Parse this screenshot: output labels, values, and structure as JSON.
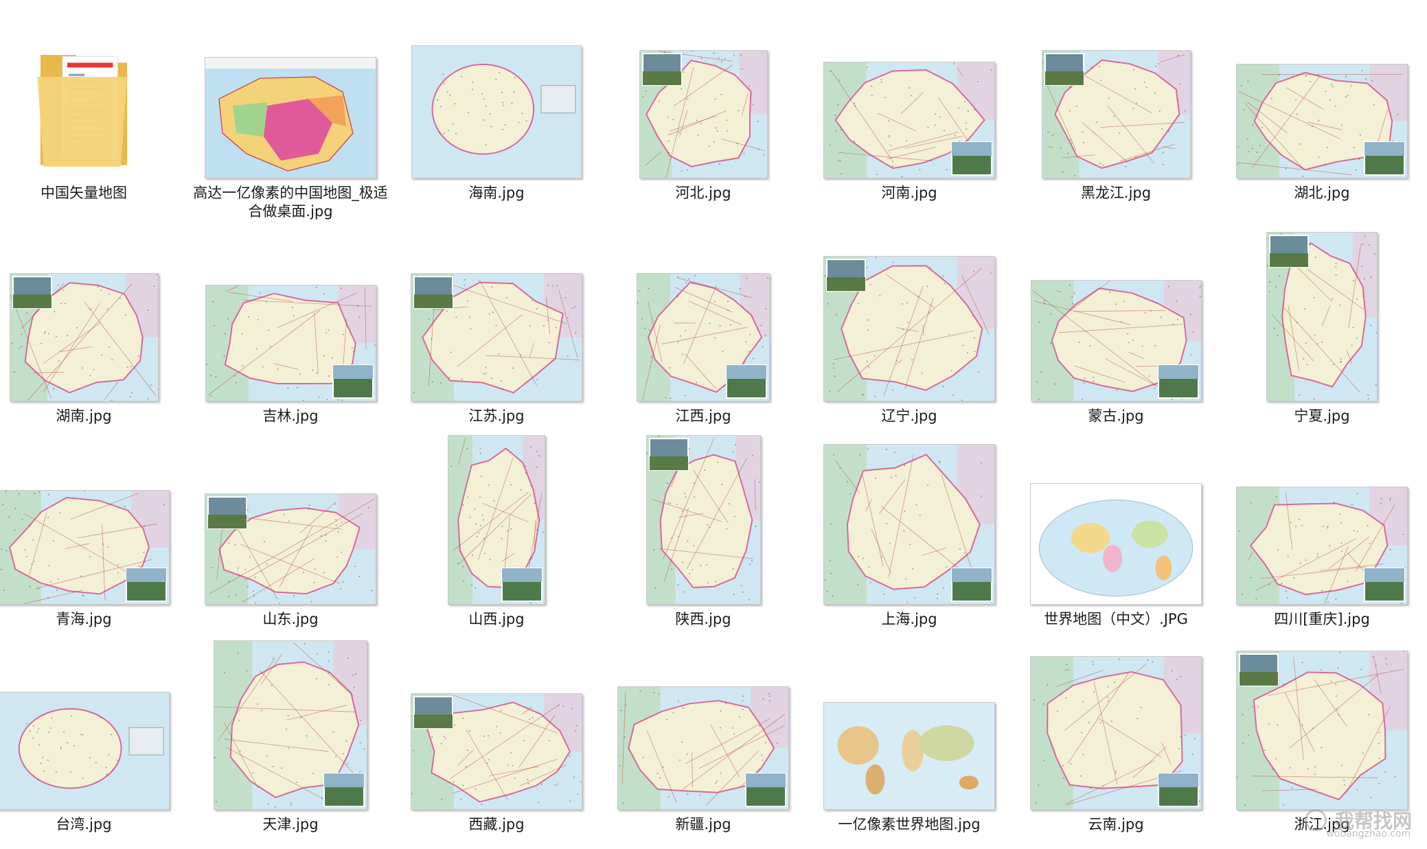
{
  "colors": {
    "sea": "#cfe7f2",
    "land": "#f3f0d6",
    "border": "#d66a9a",
    "road": "#b84a3a",
    "green": "#b9dcae",
    "pink": "#efc6d8",
    "folder": "#f5d37a"
  },
  "watermark": {
    "cn": "我帮找网",
    "en": "wobangzhao.com"
  },
  "files": [
    {
      "label": "中国矢量地图",
      "icon": "folder-icon",
      "kind": "folder"
    },
    {
      "label": "高达一亿像素的中国地图_极适合做桌面.jpg",
      "icon": "china-map-thumbnail",
      "kind": "china"
    },
    {
      "label": "海南.jpg",
      "icon": "hainan-map-thumbnail",
      "kind": "island"
    },
    {
      "label": "河北.jpg",
      "icon": "hebei-map-thumbnail",
      "kind": "province"
    },
    {
      "label": "河南.jpg",
      "icon": "henan-map-thumbnail",
      "kind": "province"
    },
    {
      "label": "黑龙江.jpg",
      "icon": "heilongjiang-map-thumbnail",
      "kind": "province"
    },
    {
      "label": "湖北.jpg",
      "icon": "hubei-map-thumbnail",
      "kind": "province"
    },
    {
      "label": "湖南.jpg",
      "icon": "hunan-map-thumbnail",
      "kind": "province"
    },
    {
      "label": "吉林.jpg",
      "icon": "jilin-map-thumbnail",
      "kind": "province"
    },
    {
      "label": "江苏.jpg",
      "icon": "jiangsu-map-thumbnail",
      "kind": "province"
    },
    {
      "label": "江西.jpg",
      "icon": "jiangxi-map-thumbnail",
      "kind": "province"
    },
    {
      "label": "辽宁.jpg",
      "icon": "liaoning-map-thumbnail",
      "kind": "province"
    },
    {
      "label": "蒙古.jpg",
      "icon": "mongolia-map-thumbnail",
      "kind": "province"
    },
    {
      "label": "宁夏.jpg",
      "icon": "ningxia-map-thumbnail",
      "kind": "province"
    },
    {
      "label": "青海.jpg",
      "icon": "qinghai-map-thumbnail",
      "kind": "province"
    },
    {
      "label": "山东.jpg",
      "icon": "shandong-map-thumbnail",
      "kind": "province"
    },
    {
      "label": "山西.jpg",
      "icon": "shanxi-map-thumbnail",
      "kind": "province"
    },
    {
      "label": "陕西.jpg",
      "icon": "shaanxi-map-thumbnail",
      "kind": "province"
    },
    {
      "label": "上海.jpg",
      "icon": "shanghai-map-thumbnail",
      "kind": "province"
    },
    {
      "label": "世界地图（中文）.JPG",
      "icon": "world-map-chinese-thumbnail",
      "kind": "worldoval"
    },
    {
      "label": "四川[重庆].jpg",
      "icon": "sichuan-map-thumbnail",
      "kind": "province"
    },
    {
      "label": "台湾.jpg",
      "icon": "taiwan-map-thumbnail",
      "kind": "island"
    },
    {
      "label": "天津.jpg",
      "icon": "tianjin-map-thumbnail",
      "kind": "province"
    },
    {
      "label": "西藏.jpg",
      "icon": "tibet-map-thumbnail",
      "kind": "province"
    },
    {
      "label": "新疆.jpg",
      "icon": "xinjiang-map-thumbnail",
      "kind": "province"
    },
    {
      "label": "一亿像素世界地图.jpg",
      "icon": "world-map-thumbnail",
      "kind": "worldflat"
    },
    {
      "label": "云南.jpg",
      "icon": "yunnan-map-thumbnail",
      "kind": "province"
    },
    {
      "label": "浙江.jpg",
      "icon": "zhejiang-map-thumbnail",
      "kind": "province"
    }
  ]
}
